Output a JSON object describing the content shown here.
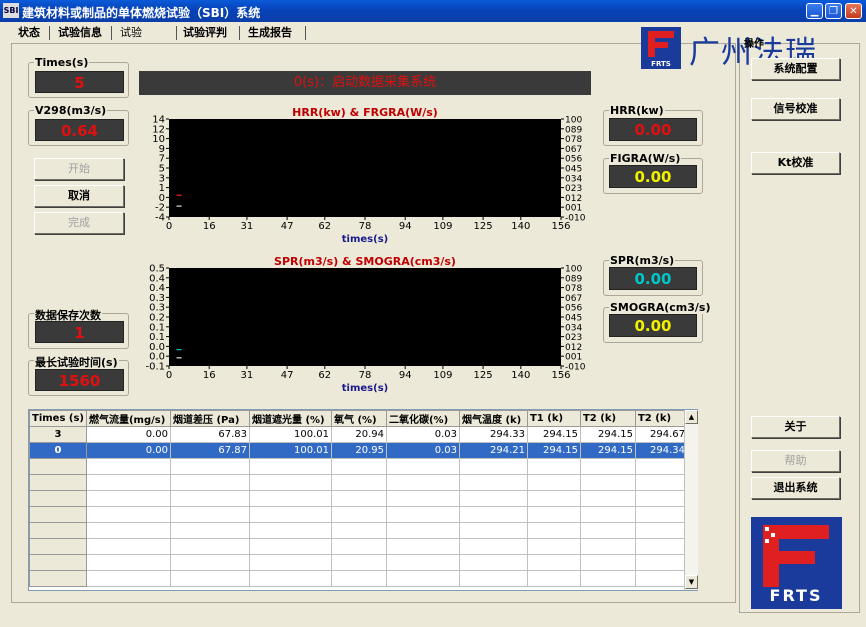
{
  "window": {
    "app_icon": "SBI",
    "title": "建筑材料或制品的单体燃烧试验（SBI）系统",
    "minimize_icon": "minimize-icon",
    "restore_icon": "restore-icon",
    "close_icon": "close-icon"
  },
  "tabs": [
    {
      "label": "状态"
    },
    {
      "label": "试验信息"
    },
    {
      "label": "试验",
      "selected": true
    },
    {
      "label": "试验评判"
    },
    {
      "label": "生成报告"
    }
  ],
  "logo": {
    "text": "广州法瑞",
    "sub": "FRTS",
    "overlay_label": "操作"
  },
  "status_message": "0(s)：启动数据采集系统",
  "left": {
    "times_label": "Times(s)",
    "times_value": "5",
    "v298_label": "V298(m3/s)",
    "v298_value": "0.64",
    "start_btn": "开始",
    "cancel_btn": "取消",
    "finish_btn": "完成",
    "save_count_label": "数据保存次数",
    "save_count_value": "1",
    "max_time_label": "最长试验时间(s)",
    "max_time_value": "1560"
  },
  "right_readouts": {
    "hrr_label": "HRR(kw)",
    "hrr_value": "0.00",
    "figra_label": "FIGRA(W/s)",
    "figra_value": "0.00",
    "spr_label": "SPR(m3/s)",
    "spr_value": "0.00",
    "smogra_label": "SMOGRA(cm3/s)",
    "smogra_value": "0.00"
  },
  "side_buttons": {
    "config": "系统配置",
    "signal_cal": "信号校准",
    "kt_cal": "Kt校准",
    "about": "关于",
    "help": "帮助",
    "exit": "退出系统"
  },
  "chart_data": [
    {
      "type": "line",
      "title": "HRR(kw) & FRGRA(W/s)",
      "xlabel": "times(s)",
      "x_ticks": [
        "0",
        "16",
        "31",
        "47",
        "62",
        "78",
        "94",
        "109",
        "125",
        "140",
        "156"
      ],
      "xlim": [
        0,
        156
      ],
      "y_left_ticks": [
        "14",
        "12",
        "10",
        "9",
        "7",
        "5",
        "3",
        "1",
        "0",
        "-2",
        "-4"
      ],
      "y_right_ticks": [
        "100",
        "089",
        "078",
        "067",
        "056",
        "045",
        "034",
        "023",
        "012",
        "001",
        "-010"
      ],
      "background": "#000000",
      "grid": false,
      "series": [
        {
          "color": "#ff2020",
          "x": [
            3,
            5
          ],
          "y": [
            0,
            0
          ]
        },
        {
          "color": "#e0e0e0",
          "x": [
            3,
            5
          ],
          "y": [
            -2,
            -2
          ]
        }
      ]
    },
    {
      "type": "line",
      "title": "SPR(m3/s) & SMOGRA(cm3/s)",
      "xlabel": "times(s)",
      "x_ticks": [
        "0",
        "16",
        "31",
        "47",
        "62",
        "78",
        "94",
        "109",
        "125",
        "140",
        "156"
      ],
      "xlim": [
        0,
        156
      ],
      "y_left_ticks": [
        "0.5",
        "0.4",
        "0.4",
        "0.3",
        "0.3",
        "0.2",
        "0.1",
        "0.1",
        "0.0",
        "0.0",
        "-0.1"
      ],
      "y_right_ticks": [
        "100",
        "089",
        "078",
        "067",
        "056",
        "045",
        "034",
        "023",
        "012",
        "001",
        "-010"
      ],
      "background": "#000000",
      "grid": false,
      "series": [
        {
          "color": "#00c8c8",
          "x": [
            3,
            5
          ],
          "y": [
            0.0,
            0.0
          ]
        },
        {
          "color": "#e0e0e0",
          "x": [
            3,
            5
          ],
          "y": [
            -0.05,
            -0.05
          ]
        }
      ]
    }
  ],
  "table": {
    "columns": [
      "Times (s)",
      "燃气流量(mg/s)",
      "烟道差压 (Pa)",
      "烟道遮光量 (%)",
      "氧气 (%)",
      "二氧化碳(%)",
      "烟气温度 (k)",
      "T1 (k)",
      "T2 (k)",
      "T2 (k)"
    ],
    "rows": [
      [
        "3",
        "0.00",
        "67.83",
        "100.01",
        "20.94",
        "0.03",
        "294.33",
        "294.15",
        "294.15",
        "294.67"
      ],
      [
        "0",
        "0.00",
        "67.87",
        "100.01",
        "20.95",
        "0.03",
        "294.21",
        "294.15",
        "294.15",
        "294.34"
      ]
    ],
    "selected_row": 1,
    "scroll_up_icon": "scroll-up-icon",
    "scroll_down_icon": "scroll-down-icon"
  }
}
